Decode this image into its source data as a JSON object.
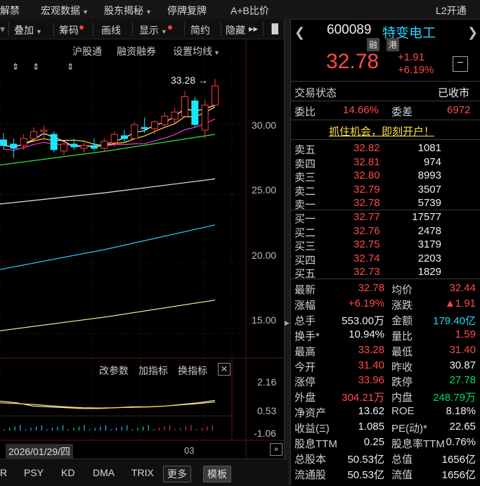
{
  "topbar": {
    "items": [
      "解禁",
      "宏观数据",
      "股东揭秘",
      "停牌复牌",
      "A+B比价",
      "L2开通"
    ]
  },
  "toolbar": {
    "items": [
      "叠加",
      "筹码",
      "画线",
      "显示",
      "简约",
      "隐藏"
    ],
    "more": "▸▸"
  },
  "chart": {
    "links": [
      "沪股通",
      "融资融券",
      "设置均线"
    ],
    "max_label": "33.28",
    "y_ticks": [
      "30.00",
      "25.00",
      "20.00",
      "15.00"
    ],
    "sub_links": [
      "改参数",
      "加指标",
      "换指标"
    ],
    "sub_ticks": [
      "2.16",
      "0.53",
      "-1.06"
    ],
    "date_label": "2026/01/29/四",
    "month_label": "03"
  },
  "bottombar": {
    "items": [
      "R",
      "PSY",
      "KD",
      "DMA",
      "TRIX"
    ],
    "more": "更多",
    "template": "模板"
  },
  "quote": {
    "code": "600089",
    "name": "特变电工",
    "tags": [
      "融",
      "港"
    ],
    "price": "32.78",
    "change": "+1.91",
    "change_pct": "+6.19%",
    "status_label": "交易状态",
    "status_value": "已收市",
    "weibi_label": "委比",
    "weibi_value": "14.66%",
    "weicha_label": "委差",
    "weicha_value": "6972",
    "promo": "抓住机会，即刻开户！",
    "asks": [
      {
        "label": "卖五",
        "price": "32.82",
        "vol": "1081"
      },
      {
        "label": "卖四",
        "price": "32.81",
        "vol": "974"
      },
      {
        "label": "卖三",
        "price": "32.80",
        "vol": "8993"
      },
      {
        "label": "卖二",
        "price": "32.79",
        "vol": "3507"
      },
      {
        "label": "卖一",
        "price": "32.78",
        "vol": "5739"
      }
    ],
    "bids": [
      {
        "label": "买一",
        "price": "32.77",
        "vol": "17577"
      },
      {
        "label": "买二",
        "price": "32.76",
        "vol": "2478"
      },
      {
        "label": "买三",
        "price": "32.75",
        "vol": "3179"
      },
      {
        "label": "买四",
        "price": "32.74",
        "vol": "2203"
      },
      {
        "label": "买五",
        "price": "32.73",
        "vol": "1829"
      }
    ],
    "stats": [
      {
        "l1": "最新",
        "v1": "32.78",
        "c1": "red",
        "l2": "均价",
        "v2": "32.44",
        "c2": "red"
      },
      {
        "l1": "涨幅",
        "v1": "+6.19%",
        "c1": "red",
        "l2": "涨跌",
        "v2": "▲1.91",
        "c2": "red"
      },
      {
        "l1": "总手",
        "v1": "553.00万",
        "c1": "white",
        "l2": "金额",
        "v2": "179.40亿",
        "c2": "cyan"
      },
      {
        "l1": "换手*",
        "v1": "10.94%",
        "c1": "white",
        "l2": "量比",
        "v2": "1.59",
        "c2": "red"
      },
      {
        "l1": "最高",
        "v1": "33.28",
        "c1": "red",
        "l2": "最低",
        "v2": "31.40",
        "c2": "red"
      },
      {
        "l1": "今开",
        "v1": "31.40",
        "c1": "red",
        "l2": "昨收",
        "v2": "30.87",
        "c2": "white"
      },
      {
        "l1": "涨停",
        "v1": "33.96",
        "c1": "red",
        "l2": "跌停",
        "v2": "27.78",
        "c2": "green"
      },
      {
        "l1": "外盘",
        "v1": "304.21万",
        "c1": "red",
        "l2": "内盘",
        "v2": "248.79万",
        "c2": "green"
      },
      {
        "l1": "净资产",
        "v1": "13.62",
        "c1": "white",
        "l2": "ROE",
        "v2": "8.18%",
        "c2": "white"
      },
      {
        "l1": "收益(Ξ)",
        "v1": "1.085",
        "c1": "white",
        "l2": "PE(动)*",
        "v2": "22.65",
        "c2": "white"
      },
      {
        "l1": "股息TTM",
        "v1": "0.25",
        "c1": "white",
        "l2": "股息率TTM",
        "v2": "0.76%",
        "c2": "white"
      },
      {
        "l1": "总股本",
        "v1": "50.53亿",
        "c1": "white",
        "l2": "总值",
        "v2": "1656亿",
        "c2": "white"
      },
      {
        "l1": "流通股",
        "v1": "50.53亿",
        "c1": "white",
        "l2": "流值",
        "v2": "1656亿",
        "c2": "white"
      }
    ]
  },
  "chart_data": {
    "type": "candlestick",
    "y_ticks": [
      15.0,
      20.0,
      25.0,
      30.0
    ],
    "ylim": [
      13.5,
      34.5
    ],
    "max_marked": 33.28,
    "candles": [
      {
        "o": 28.9,
        "h": 29.4,
        "l": 28.2,
        "c": 28.5
      },
      {
        "o": 28.6,
        "h": 29.0,
        "l": 27.6,
        "c": 28.3
      },
      {
        "o": 28.5,
        "h": 29.3,
        "l": 28.2,
        "c": 29.0
      },
      {
        "o": 29.0,
        "h": 29.8,
        "l": 28.7,
        "c": 29.5
      },
      {
        "o": 29.5,
        "h": 29.9,
        "l": 28.9,
        "c": 29.6
      },
      {
        "o": 29.3,
        "h": 29.5,
        "l": 28.0,
        "c": 28.2
      },
      {
        "o": 28.1,
        "h": 28.8,
        "l": 27.8,
        "c": 28.6
      },
      {
        "o": 28.6,
        "h": 29.0,
        "l": 28.2,
        "c": 28.4
      },
      {
        "o": 28.3,
        "h": 28.7,
        "l": 28.0,
        "c": 28.5
      },
      {
        "o": 28.5,
        "h": 29.0,
        "l": 28.1,
        "c": 28.3
      },
      {
        "o": 28.3,
        "h": 29.0,
        "l": 28.0,
        "c": 28.8
      },
      {
        "o": 28.7,
        "h": 29.5,
        "l": 28.4,
        "c": 29.3
      },
      {
        "o": 29.2,
        "h": 29.6,
        "l": 28.7,
        "c": 29.0
      },
      {
        "o": 29.0,
        "h": 30.2,
        "l": 28.9,
        "c": 30.0
      },
      {
        "o": 29.8,
        "h": 30.5,
        "l": 29.4,
        "c": 29.7
      },
      {
        "o": 29.7,
        "h": 30.3,
        "l": 29.3,
        "c": 30.2
      },
      {
        "o": 30.0,
        "h": 30.9,
        "l": 29.8,
        "c": 30.6
      },
      {
        "o": 30.4,
        "h": 31.2,
        "l": 30.1,
        "c": 30.9
      },
      {
        "o": 30.6,
        "h": 32.4,
        "l": 30.5,
        "c": 32.0
      },
      {
        "o": 31.7,
        "h": 32.0,
        "l": 29.8,
        "c": 30.0
      },
      {
        "o": 29.6,
        "h": 31.8,
        "l": 29.0,
        "c": 31.4
      },
      {
        "o": 31.4,
        "h": 33.28,
        "l": 31.4,
        "c": 32.78
      }
    ]
  }
}
